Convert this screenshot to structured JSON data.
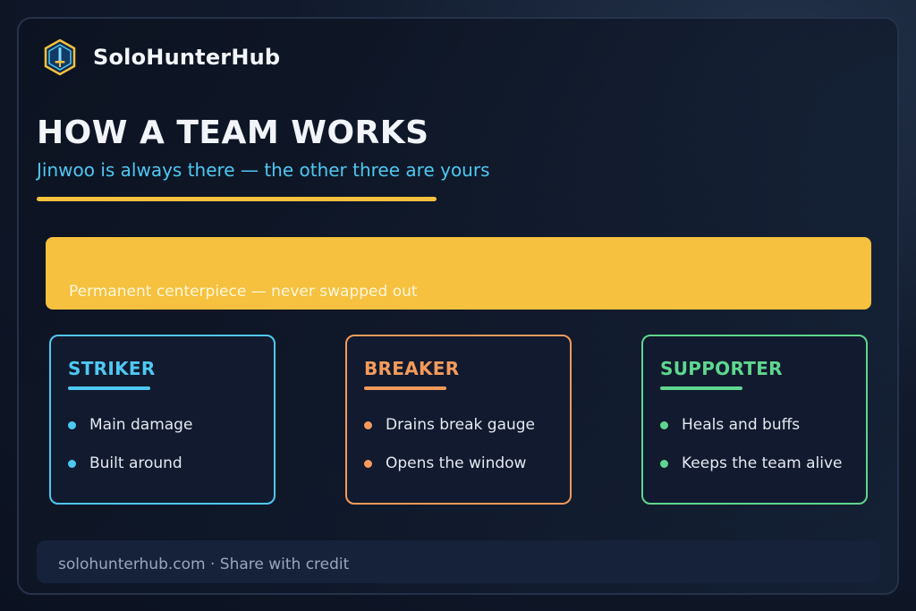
{
  "brand": {
    "name": "SoloHunterHub",
    "logo_icon": "hexagon-sword-icon"
  },
  "header": {
    "title": "HOW A TEAM WORKS",
    "subtitle": "Jinwoo is always there — the other three are yours"
  },
  "banner": {
    "text": "Permanent centerpiece — never swapped out",
    "color": "#f5c13e"
  },
  "roles": [
    {
      "title": "STRIKER",
      "color": "#4ec8f2",
      "items": [
        "Main damage",
        "Built around"
      ]
    },
    {
      "title": "BREAKER",
      "color": "#f59a5b",
      "items": [
        "Drains break gauge",
        "Opens the window"
      ]
    },
    {
      "title": "SUPPORTER",
      "color": "#5fd68f",
      "items": [
        "Heals and buffs",
        "Keeps the team alive"
      ]
    }
  ],
  "footer": {
    "text": "solohunterhub.com · Share with credit"
  },
  "colors": {
    "accent_yellow": "#f5c13e",
    "accent_cyan": "#4ec8f2",
    "background": "#0b1120"
  }
}
